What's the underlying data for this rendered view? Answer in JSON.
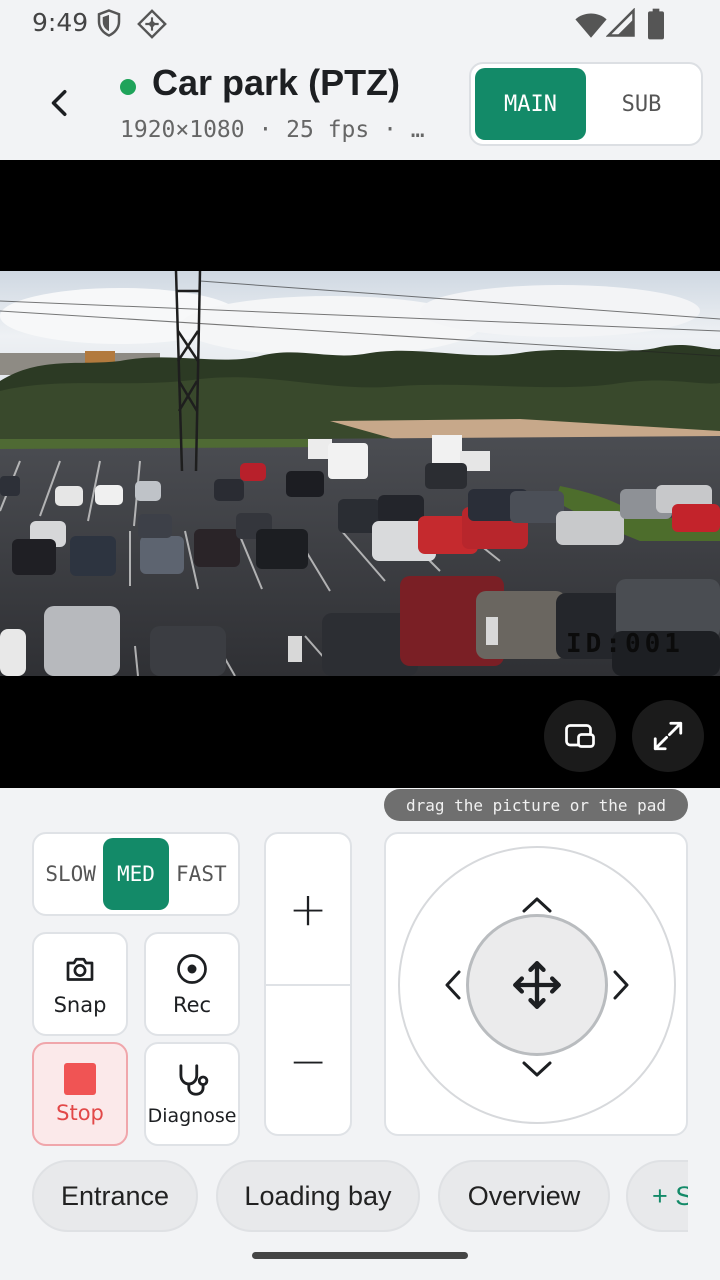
{
  "status": {
    "time": "9:49",
    "icons": [
      "shield-icon",
      "location-crosshair-icon",
      "wifi-icon",
      "signal-icon",
      "battery-icon"
    ]
  },
  "header": {
    "title": "Car park (PTZ)",
    "subtitle": "1920×1080 · 25 fps · …",
    "live_color": "#1fa35a",
    "stream_options": [
      "MAIN",
      "SUB"
    ],
    "selected_stream": "MAIN"
  },
  "video": {
    "osd_label": "ID:001",
    "hint": "drag the picture or the pad"
  },
  "controls": {
    "speed_options": [
      "SLOW",
      "MED",
      "FAST"
    ],
    "selected_speed": "MED",
    "actions": {
      "snap": "Snap",
      "rec": "Rec",
      "stop": "Stop",
      "diagnose": "Diagnose"
    },
    "zoom_in": "+",
    "zoom_out": "−"
  },
  "presets": [
    "Entrance",
    "Loading bay",
    "Overview",
    "+ S"
  ],
  "colors": {
    "accent": "#138a68",
    "danger": "#e24848",
    "danger_bg": "#fbe9ea"
  }
}
